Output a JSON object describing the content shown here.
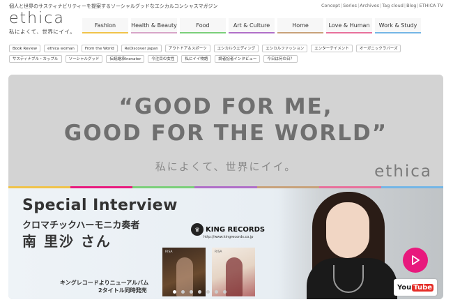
{
  "header": {
    "tagline": "個人と世界のサスティナビリティーを提案するソーシャルグッドなエシカルコンシャスマガジン",
    "links": [
      "Concept",
      "Series",
      "Archives",
      "Tag cloud",
      "Blog",
      "ETHICA TV"
    ],
    "logo_word": "ethica",
    "logo_sub": "私によくて、世界にイイ。"
  },
  "categories": [
    {
      "label": "Fashion",
      "color": "#f0c34a"
    },
    {
      "label": "Health & Beauty",
      "color": "#d7a5c8"
    },
    {
      "label": "Food",
      "color": "#7bcf7a"
    },
    {
      "label": "Art & Culture",
      "color": "#b06fc8"
    },
    {
      "label": "Home",
      "color": "#c8a27a"
    },
    {
      "label": "Love & Human",
      "color": "#e8709b"
    },
    {
      "label": "Work & Study",
      "color": "#74b6e6"
    }
  ],
  "tags": [
    "Book Review",
    "ethica woman",
    "From the World",
    "ReDiscover Japan",
    "アウトドア＆スポーツ",
    "エシカルウエディング",
    "エシカルファッション",
    "エンターテイメント",
    "オーガニックラバーズ",
    "サスティナブル・カップル",
    "ソーシャルグッド",
    "伝統継承Inovater",
    "今注目の女性",
    "私にイイ物語",
    "読者記者インタビュー",
    "今日は何の日？"
  ],
  "hero": {
    "quote_line1": "“GOOD FOR ME,",
    "quote_line2": "GOOD FOR THE WORLD”",
    "jp_sub": "私によくて、世界にイイ。",
    "brand": "ethica",
    "stripe_colors": [
      "#f0c34a",
      "#e8197d",
      "#7bcf7a",
      "#b06fc8",
      "#c8a27a",
      "#e8709b",
      "#74b6e6"
    ],
    "interview_title": "Special Interview",
    "interview_role": "クロマチックハーモニカ奏者",
    "interview_name": "南 里沙 さん",
    "label_name": "KING RECORDS",
    "label_url": "http://www.kingrecords.co.jp",
    "album1_label": "RISA",
    "album2_label": "RISA",
    "note_line1": "キングレコードよりニューアルバム",
    "note_line2": "2タイトル同時発売",
    "youtube_you": "You",
    "youtube_tube": "Tube",
    "play_color": "#e8197d"
  },
  "slider": {
    "count": 7,
    "active": 0
  }
}
